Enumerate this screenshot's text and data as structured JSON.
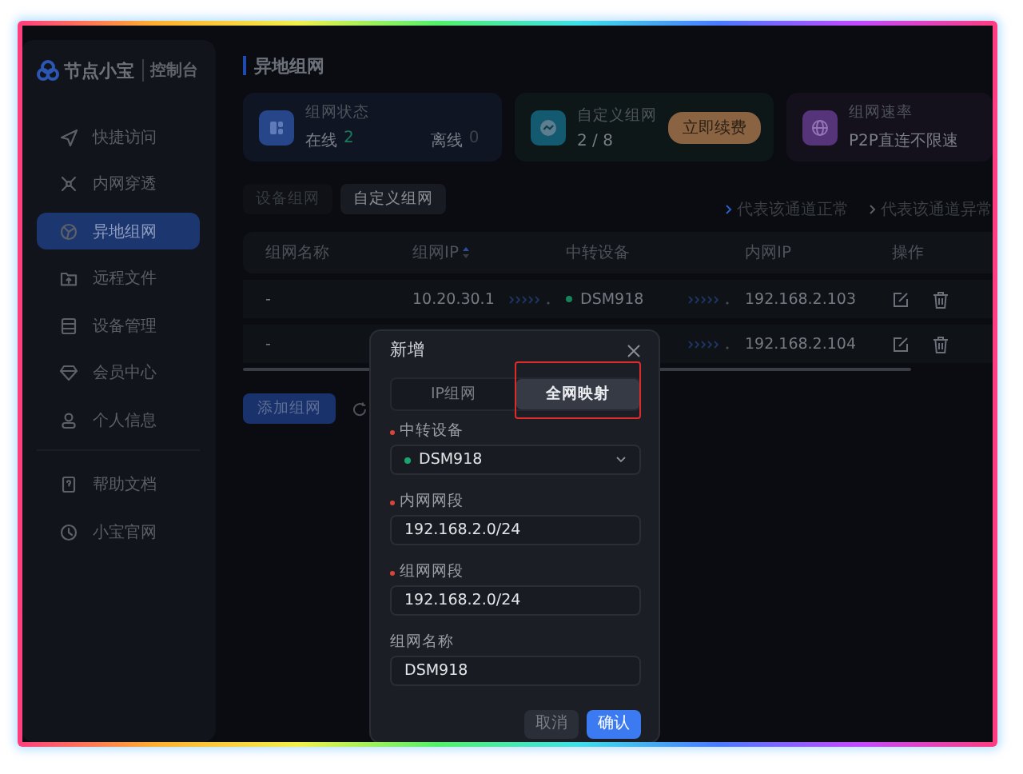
{
  "sidebar": {
    "logo": "节点小宝",
    "subtitle": "控制台",
    "groups": [
      {
        "items": [
          {
            "label": "快捷访问",
            "selected": false
          },
          {
            "label": "内网穿透",
            "selected": false
          },
          {
            "label": "异地组网",
            "selected": true
          },
          {
            "label": "远程文件",
            "selected": false
          },
          {
            "label": "设备管理",
            "selected": false
          },
          {
            "label": "会员中心",
            "selected": false
          },
          {
            "label": "个人信息",
            "selected": false
          }
        ]
      },
      {
        "items": [
          {
            "label": "帮助文档",
            "selected": false
          },
          {
            "label": "小宝官网",
            "selected": false
          }
        ]
      }
    ]
  },
  "page_title": "异地组网",
  "stats": [
    {
      "kind": "status",
      "label": "组网状态",
      "online_label": "在线",
      "online": "2",
      "offline_label": "离线",
      "offline": "0"
    },
    {
      "kind": "quota",
      "label": "自定义组网",
      "value": "2 / 8",
      "action": "立即续费"
    },
    {
      "kind": "speed",
      "label": "组网速率",
      "value": "P2P直连不限速"
    }
  ],
  "mode_tabs": [
    {
      "label": "设备组网",
      "selected": false
    },
    {
      "label": "自定义组网",
      "selected": true
    }
  ],
  "legend": [
    {
      "label": "代表该通道正常",
      "color": "#2b5fc4"
    },
    {
      "label": "代表该通道异常",
      "color": "#5a5e66"
    }
  ],
  "table": {
    "columns": [
      {
        "label": "组网名称",
        "sortable": false
      },
      {
        "label": "组网IP",
        "sortable": true
      },
      {
        "label": "中转设备",
        "sortable": false
      },
      {
        "label": "内网IP",
        "sortable": false
      },
      {
        "label": "操作",
        "sortable": false
      }
    ],
    "rows": [
      {
        "name": "-",
        "ip": "10.20.30.1",
        "device": "DSM918",
        "device_online": true,
        "lan_ip": "192.168.2.103"
      },
      {
        "name": "-",
        "lan_ip": "192.168.2.104"
      }
    ]
  },
  "add_button": "添加组网",
  "dialog": {
    "title": "新增",
    "segments": [
      {
        "label": "IP组网",
        "selected": false,
        "highlighted": false
      },
      {
        "label": "全网映射",
        "selected": true,
        "highlighted": true
      }
    ],
    "fields": [
      {
        "kind": "select",
        "label": "中转设备",
        "required": true,
        "value": "DSM918",
        "online": true
      },
      {
        "kind": "input",
        "label": "内网网段",
        "required": true,
        "value": "192.168.2.0/24"
      },
      {
        "kind": "input",
        "label": "组网网段",
        "required": true,
        "value": "192.168.2.0/24"
      },
      {
        "kind": "input",
        "label": "组网名称",
        "required": false,
        "value": "DSM918"
      }
    ],
    "buttons": [
      {
        "kind": "secondary",
        "label": "取消"
      },
      {
        "kind": "primary",
        "label": "确认"
      }
    ]
  }
}
